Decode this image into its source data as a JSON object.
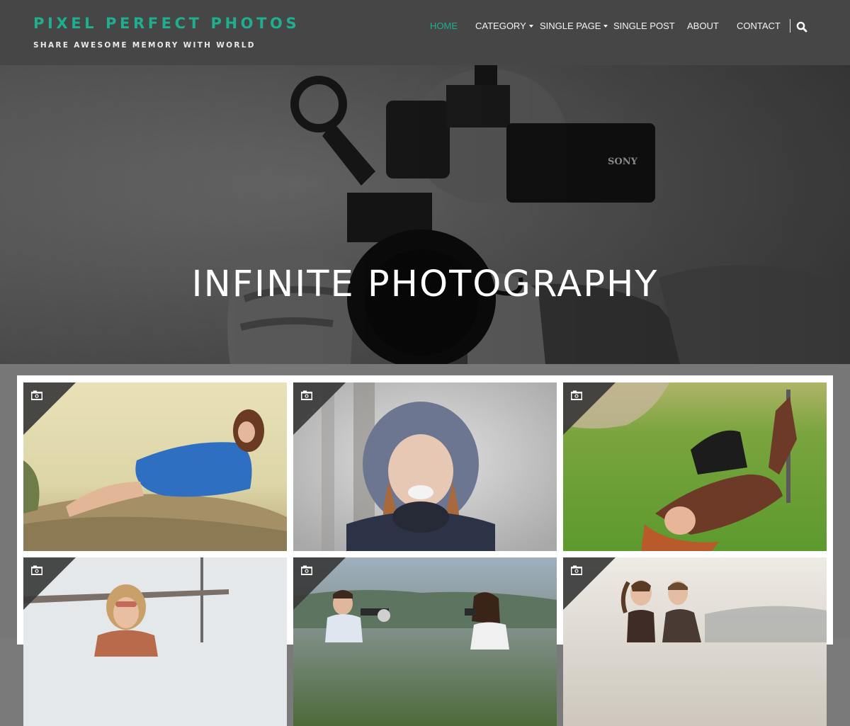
{
  "header": {
    "site_title": "PIXEL PERFECT PHOTOS",
    "tagline": "SHARE AWESOME MEMORY WITH WORLD",
    "brand_color": "#1fae8f"
  },
  "nav": {
    "items": [
      {
        "label": "HOME",
        "active": true,
        "has_dropdown": false
      },
      {
        "label": "CATEGORY",
        "active": false,
        "has_dropdown": true
      },
      {
        "label": "SINGLE PAGE",
        "active": false,
        "has_dropdown": true
      },
      {
        "label": "SINGLE POST",
        "active": false,
        "has_dropdown": false
      },
      {
        "label": "ABOUT",
        "active": false,
        "has_dropdown": false
      },
      {
        "label": "CONTACT",
        "active": false,
        "has_dropdown": false
      }
    ],
    "search_icon": "search-icon"
  },
  "hero": {
    "title": "INFINITE PHOTOGRAPHY",
    "background": "photographer holding camera (grayscale)",
    "camera_brand_text": "SONY"
  },
  "gallery": {
    "post_format_icon": "camera-icon",
    "items": [
      {
        "subject": "woman in blue dress lying on rocks"
      },
      {
        "subject": "girl in fur hood blowing snow"
      },
      {
        "subject": "woman lying on grass"
      },
      {
        "subject": "woman with sunglasses outdoors"
      },
      {
        "subject": "boy and girl with cameras"
      },
      {
        "subject": "two children facing each other"
      }
    ]
  }
}
